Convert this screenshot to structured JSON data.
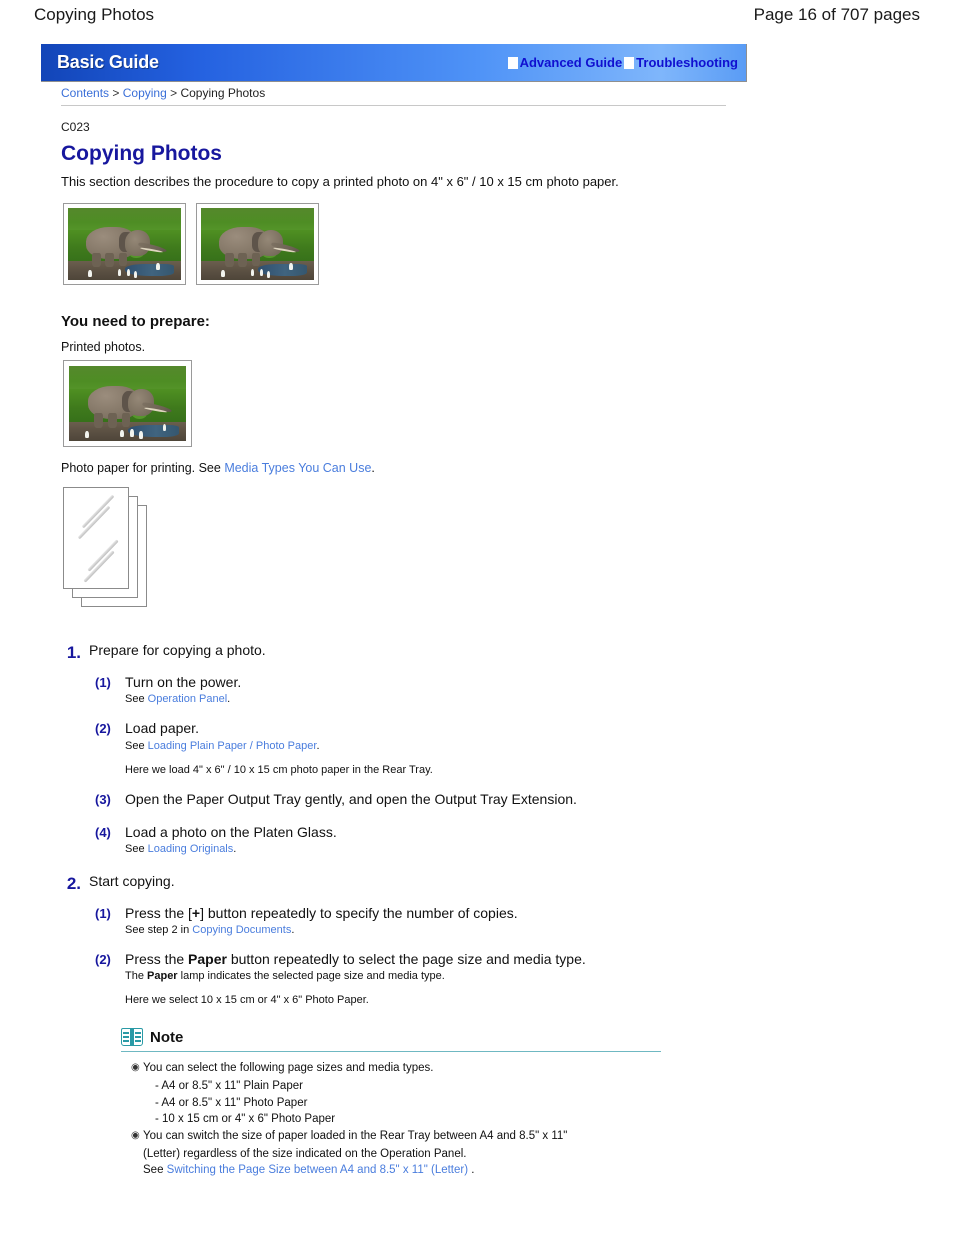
{
  "page_header": {
    "title": "Copying Photos",
    "page_info": "Page 16 of 707 pages"
  },
  "banner": {
    "brand": "Basic Guide",
    "links": [
      {
        "label": "Advanced Guide",
        "icon": "link-box-icon"
      },
      {
        "label": "Troubleshooting",
        "icon": "link-box-icon"
      }
    ]
  },
  "breadcrumb": {
    "items": [
      {
        "label": "Contents",
        "link": true
      },
      {
        "label": "Copying",
        "link": true
      },
      {
        "label": "Copying Photos",
        "link": false
      }
    ],
    "separator": ">"
  },
  "doc": {
    "code": "C023",
    "title": "Copying Photos",
    "intro": "This section describes the procedure to copy a printed photo on 4\" x 6\" / 10 x 15 cm photo paper."
  },
  "photos": {
    "caption_alt": "elephant-photo",
    "count": 2
  },
  "prepare": {
    "heading": "You need to prepare:",
    "line1": "Printed photos.",
    "line2_prefix": "Photo paper for printing. See ",
    "line2_link": "Media Types You Can Use",
    "line2_suffix": "."
  },
  "steps": [
    {
      "num": "1.",
      "title": "Prepare for copying a photo.",
      "substeps": [
        {
          "num": "(1)",
          "title": "Turn on the power.",
          "note_prefix": "See ",
          "note_link": "Operation Panel",
          "note_suffix": "."
        },
        {
          "num": "(2)",
          "title": "Load paper.",
          "note_prefix": "See ",
          "note_link": "Loading Plain Paper / Photo Paper",
          "note_suffix": ".",
          "extra": "Here we load 4\" x 6\" / 10 x 15 cm photo paper in the Rear Tray."
        },
        {
          "num": "(3)",
          "title": "Open the Paper Output Tray gently, and open the Output Tray Extension."
        },
        {
          "num": "(4)",
          "title": "Load a photo on the Platen Glass.",
          "note_prefix": "See ",
          "note_link": "Loading Originals",
          "note_suffix": "."
        }
      ]
    },
    {
      "num": "2.",
      "title": "Start copying.",
      "substeps": [
        {
          "num": "(1)",
          "title_part1": "Press the [",
          "title_button": "+",
          "title_part2": "] button repeatedly to specify the number of copies.",
          "note_prefix": "See step 2 in ",
          "note_link": "Copying Documents",
          "note_suffix": "."
        },
        {
          "num": "(2)",
          "title_part1": "Press the ",
          "title_button": "Paper",
          "title_part2": " button repeatedly to select the page size and media type.",
          "note_prefix": "The ",
          "note_bold": "Paper",
          "note_suffix": " lamp indicates the selected page size and media type.",
          "extra": "Here we select 10 x 15 cm or 4\" x 6\" Photo Paper."
        }
      ]
    }
  ],
  "note": {
    "icon": "open-book-icon",
    "label": "Note",
    "items": [
      {
        "text": "You can select the following page sizes and media types.",
        "sublines": [
          "- A4 or 8.5\" x 11\" Plain Paper",
          "- A4 or 8.5\" x 11\" Photo Paper",
          "- 10 x 15 cm or 4\" x 6\" Photo Paper"
        ]
      },
      {
        "text": "You can switch the size of paper loaded in the Rear Tray between A4 and 8.5\" x 11\"",
        "cont": [
          "(Letter) regardless of the size indicated on the Operation Panel."
        ],
        "see_prefix": "See ",
        "see_link": "Switching the Page Size between A4 and 8.5\" x 11\" (Letter)",
        "see_suffix": " ."
      }
    ],
    "bullet_glyph": "◉"
  },
  "colors": {
    "title_blue": "#17179e",
    "link_blue": "#4a7ddd",
    "banner_blue": "#2461e0",
    "note_teal": "#2a9aa6"
  }
}
